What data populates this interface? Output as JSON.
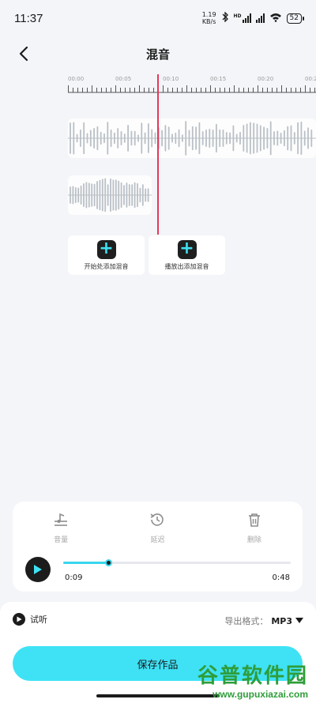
{
  "status": {
    "time": "11:37",
    "net_speed_value": "1.19",
    "net_speed_unit": "KB/s",
    "hd": "HD",
    "battery": "52"
  },
  "header": {
    "title": "混音"
  },
  "timeline": {
    "labels": [
      "00:00",
      "00:05",
      "00:10",
      "00:15",
      "00:20",
      "00:2"
    ]
  },
  "add_actions": [
    {
      "label": "开始处添加混音"
    },
    {
      "label": "播放出添加混音"
    }
  ],
  "tools": {
    "volume": "音量",
    "delay": "延迟",
    "delete": "删除"
  },
  "player": {
    "current_time": "0:09",
    "total_time": "0:48",
    "progress": 0.2
  },
  "bottom": {
    "preview_label": "试听",
    "format_label": "导出格式：",
    "format_value": "MP3",
    "save_label": "保存作品"
  },
  "watermark": {
    "text": "谷普软件园",
    "url": "www.gupuxiazai.com"
  },
  "colors": {
    "accent": "#3fe2f5",
    "playhead": "#e5385b",
    "wave": "#b9c0c6"
  }
}
